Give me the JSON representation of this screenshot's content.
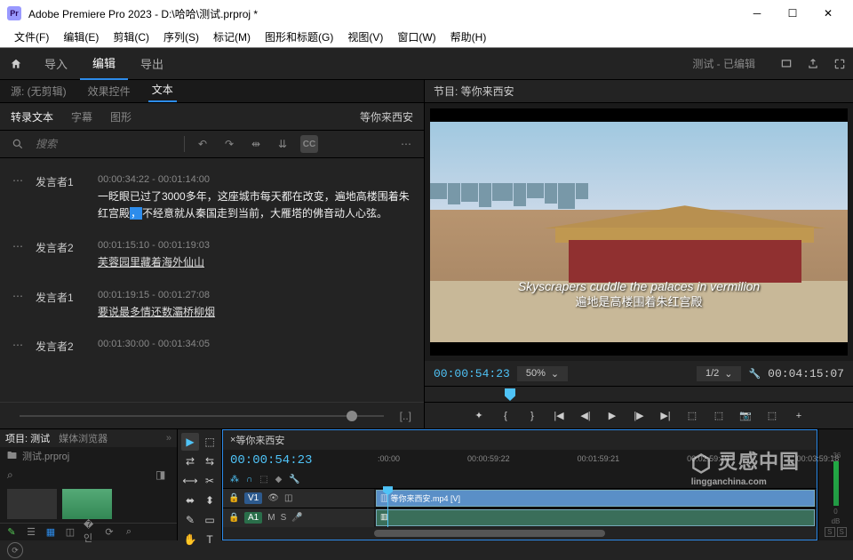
{
  "window": {
    "title": "Adobe Premiere Pro 2023 - D:\\哈哈\\测试.prproj *",
    "logo": "Pr"
  },
  "menu": {
    "file": "文件(F)",
    "edit": "编辑(E)",
    "clip": "剪辑(C)",
    "sequence": "序列(S)",
    "markers": "标记(M)",
    "graphics": "图形和标题(G)",
    "view": "视图(V)",
    "window": "窗口(W)",
    "help": "帮助(H)"
  },
  "workspace": {
    "import": "导入",
    "edit": "编辑",
    "export": "导出",
    "label": "测试 - 已编辑"
  },
  "source_tabs": {
    "source": "源: (无剪辑)",
    "effects": "效果控件",
    "text": "文本"
  },
  "text_subtabs": {
    "transcript": "转录文本",
    "captions": "字幕",
    "graphics": "图形",
    "right_label": "等你来西安"
  },
  "toolbar": {
    "search_placeholder": "搜索",
    "cc": "CC"
  },
  "transcript": [
    {
      "speaker": "发言者1",
      "tc": "00:00:34:22 - 00:01:14:00",
      "text_prefix": "一眨眼已过了3000多年，这座城市每天都在改变，遍地高楼围着朱红宫殿",
      "hl": "，",
      "text_suffix": "不经意就从秦国走到当前，大雁塔的佛音动人心弦。"
    },
    {
      "speaker": "发言者2",
      "tc": "00:01:15:10 - 00:01:19:03",
      "text": "芙蓉园里藏着海外仙山",
      "underline": true
    },
    {
      "speaker": "发言者1",
      "tc": "00:01:19:15 - 00:01:27:08",
      "text": "要说最多情还数灞桥柳烟",
      "underline": true
    },
    {
      "speaker": "发言者2",
      "tc": "00:01:30:00 - 00:01:34:05",
      "text": ""
    }
  ],
  "program": {
    "header": "节目: 等你来西安",
    "subtitle_en": "Skyscrapers cuddle the palaces in vermilion",
    "subtitle_cn": "遍地是高楼围着朱红宫殿",
    "tc": "00:00:54:23",
    "zoom": "50%",
    "scale": "1/2",
    "duration": "00:04:15:07"
  },
  "project": {
    "tab_project": "项目: 测试",
    "tab_media": "媒体浏览器",
    "filename": "测试.prproj"
  },
  "timeline": {
    "seq_name": "等你来西安",
    "tc": "00:00:54:23",
    "ruler": [
      ":00:00",
      "00:00:59:22",
      "00:01:59:21",
      "00:02:59:19",
      "00:03:59:18"
    ],
    "clip_name": "等你来西安.mp4 [V]",
    "v1": "V1",
    "a1": "A1",
    "m": "M",
    "s": "S"
  },
  "watermark": {
    "cn": "灵感中国",
    "url": "lingganchina.com"
  },
  "meter": {
    "db36": "-36",
    "db0": "0",
    "dB": "dB",
    "s": "S"
  }
}
